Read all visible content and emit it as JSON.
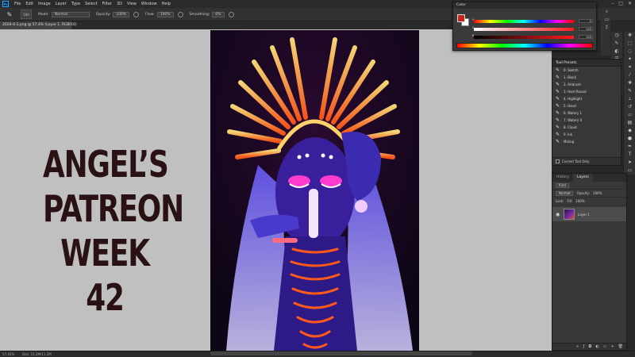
{
  "menubar": {
    "logo": "Ps",
    "items": [
      "File",
      "Edit",
      "Image",
      "Layer",
      "Type",
      "Select",
      "Filter",
      "3D",
      "View",
      "Window",
      "Help"
    ]
  },
  "options": {
    "brush_size": "100",
    "mode_label": "Mode:",
    "mode_value": "Normal",
    "opacity_label": "Opacity:",
    "opacity_value": "100%",
    "flow_label": "Flow:",
    "flow_value": "100%",
    "smoothing_label": "Smoothing:",
    "smoothing_value": "0%"
  },
  "document": {
    "tab_title": "2020-4-1.png @ 57.4% (Layer 1, RGB/16)",
    "status_zoom": "57.43%",
    "status_doc": "Doc: 11.2M/11.2M"
  },
  "canvas": {
    "title_lines": [
      "ANGEL’S",
      "PATREON",
      "WEEK 42"
    ]
  },
  "color_panel": {
    "title": "Color",
    "labels": [
      "H",
      "S",
      "B"
    ],
    "values": [
      "5",
      "100",
      "100"
    ],
    "fg_color": "#c8261c",
    "bg_color": "#ffffff"
  },
  "tool_presets": {
    "title": "Tool Presets",
    "items": [
      "0. Sketch",
      "1. Block",
      "2. Airbrush",
      "3. Hard Round",
      "4. Highlight",
      "5. Hand",
      "6. Watery 1",
      "7. Watery II",
      "8. Cloud",
      "9. Ink",
      "Mixing"
    ],
    "footer_label": "Current Tool Only"
  },
  "layers_panel": {
    "tabs": [
      "History",
      "Layers"
    ],
    "kind_label": "Kind",
    "blend_mode": "Normal",
    "opacity_label": "Opacity:",
    "opacity_value": "100%",
    "lock_label": "Lock:",
    "fill_label": "Fill:",
    "fill_value": "100%",
    "layer_name": "Layer 1"
  },
  "icons": {
    "window_controls": [
      "minimize-icon",
      "maximize-icon",
      "close-icon"
    ],
    "brush": "brush-icon",
    "eye": "eye-icon"
  }
}
